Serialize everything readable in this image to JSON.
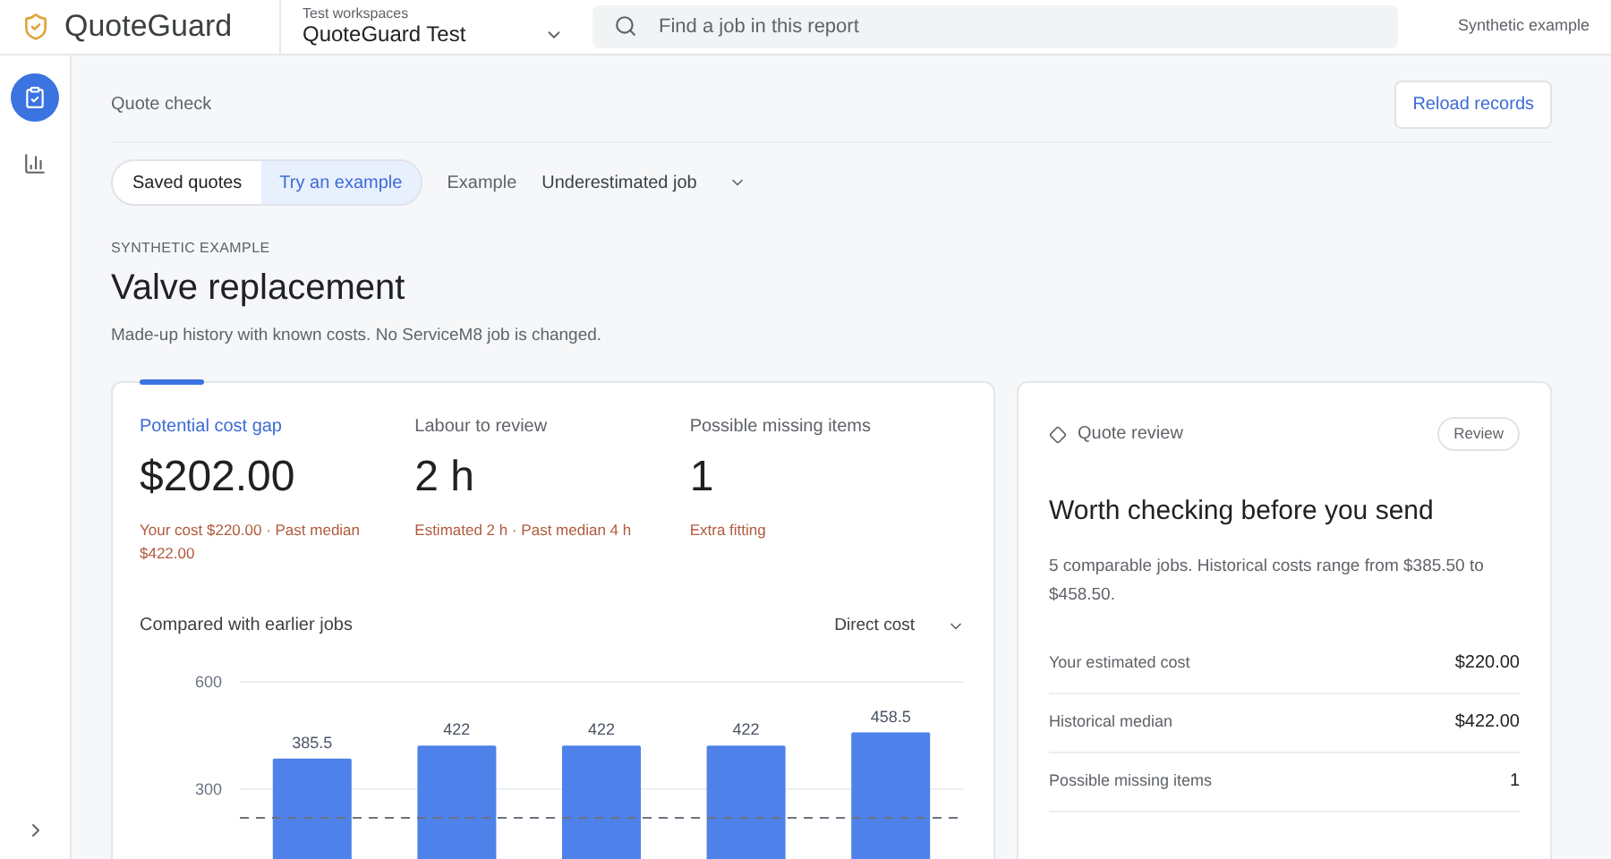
{
  "header": {
    "brand": "QuoteGuard",
    "workspace_label": "Test workspaces",
    "workspace": "QuoteGuard Test",
    "search": {
      "placeholder": "Find a job in this report"
    },
    "mode_note": "Synthetic example"
  },
  "sidebar": {
    "items": [
      {
        "kind": "check",
        "selected": true
      },
      {
        "kind": "chart",
        "selected": false
      }
    ]
  },
  "page": {
    "title": "Quote check",
    "reload_button": "Reload records"
  },
  "tabs": [
    {
      "label": "Saved quotes",
      "selected": false
    },
    {
      "label": "Try an example",
      "selected": true
    }
  ],
  "example_picker": {
    "label": "Example",
    "value": "Underestimated job"
  },
  "eyebrow": "SYNTHETIC EXAMPLE",
  "heading": "Valve replacement",
  "subtitle": "Made-up history with known costs. No ServiceM8 job is changed.",
  "stats": [
    {
      "label": "Potential cost gap",
      "value": "$202.00",
      "note": "Your cost $220.00 · Past median $422.00",
      "selected": true
    },
    {
      "label": "Labour to review",
      "value": "2 h",
      "note": "Estimated 2 h · Past median 4 h",
      "selected": false
    },
    {
      "label": "Possible missing items",
      "value": "1",
      "note": "Extra fitting",
      "selected": false
    }
  ],
  "comparison": {
    "title": "Compared with earlier jobs",
    "metric": "Direct cost",
    "chart_data": {
      "type": "bar",
      "values": [
        385.5,
        422,
        422,
        422,
        458.5
      ],
      "ylim": [
        0,
        600
      ],
      "yticks": [
        300,
        600
      ],
      "data_labels": true,
      "ref_lines": [
        {
          "axis": "y",
          "value": 220
        }
      ]
    }
  },
  "review": {
    "label": "Quote review",
    "badge": "Review",
    "heading": "Worth checking before you send",
    "summary": "5 comparable jobs. Historical costs range from $385.50 to $458.50.",
    "rows": [
      {
        "label": "Your estimated cost",
        "value": "$220.00"
      },
      {
        "label": "Historical median",
        "value": "$422.00"
      },
      {
        "label": "Possible missing items",
        "value": "1"
      }
    ]
  }
}
